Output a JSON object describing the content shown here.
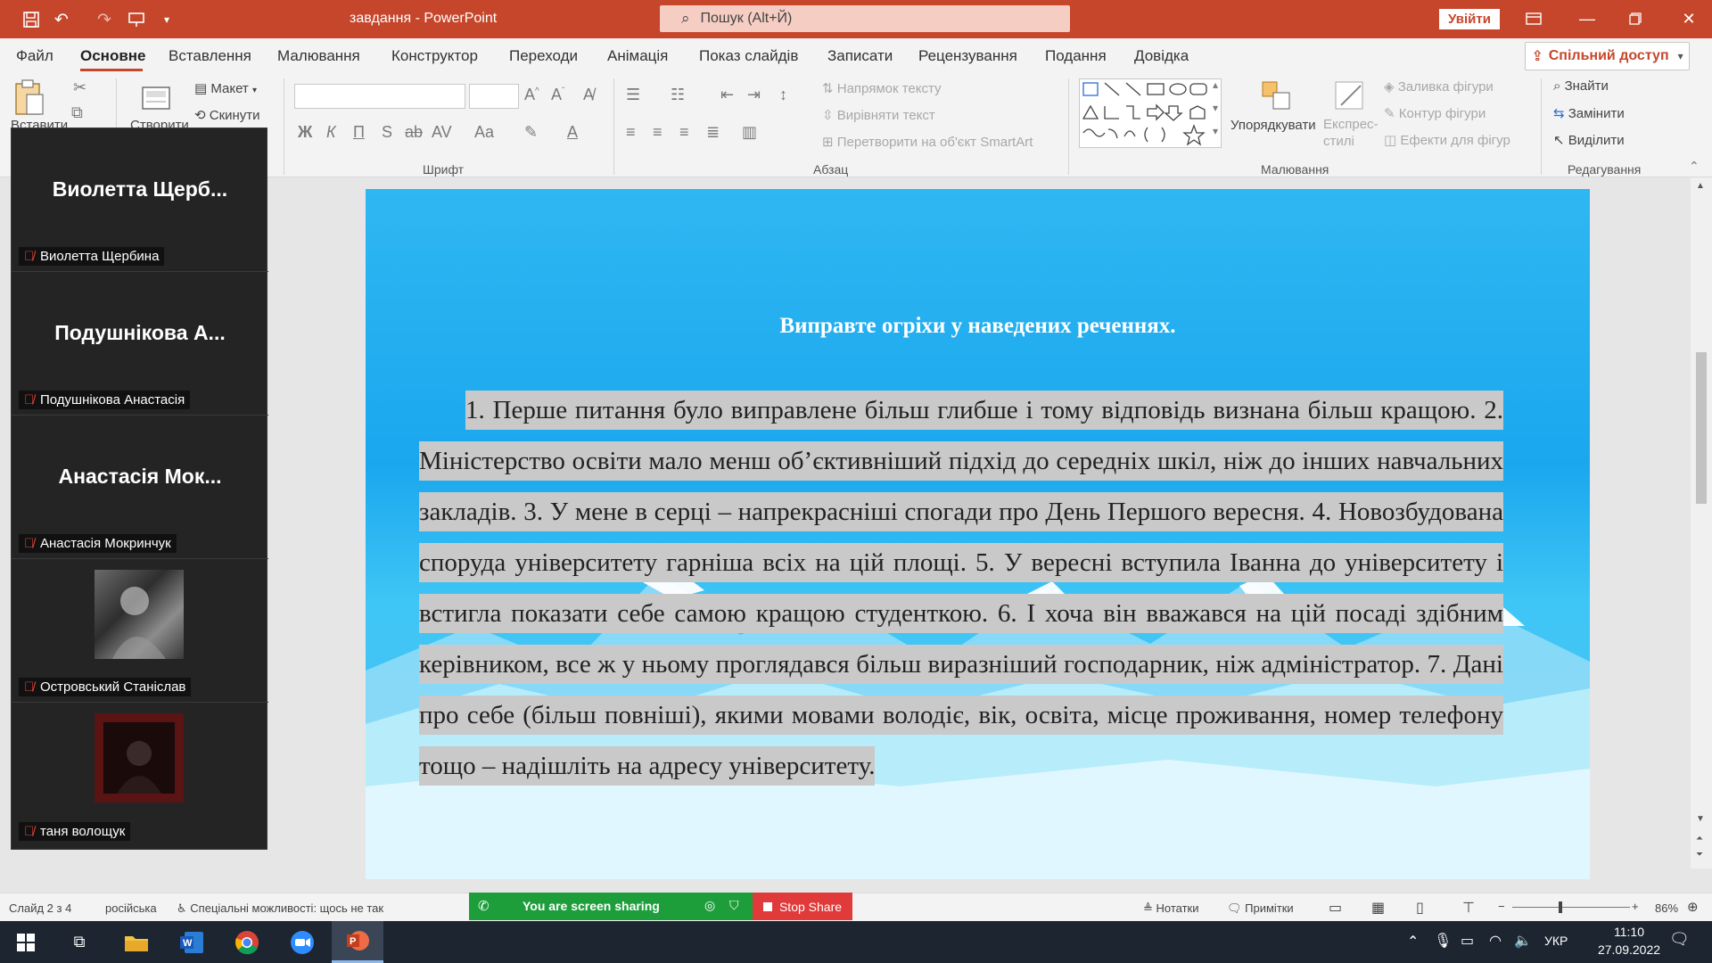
{
  "titlebar": {
    "doc_title": "завдання - PowerPoint",
    "search_placeholder": "Пошук (Alt+Й)",
    "signin_label": "Увійти"
  },
  "menu": {
    "items": [
      "Файл",
      "Основне",
      "Вставлення",
      "Малювання",
      "Конструктор",
      "Переходи",
      "Анімація",
      "Показ слайдів",
      "Записати",
      "Рецензування",
      "Подання",
      "Довідка"
    ],
    "active": "Основне",
    "share_label": "Спільний доступ"
  },
  "ribbon": {
    "paste_label": "Вставити",
    "create_label": "Створити",
    "layout_label": "Макет",
    "reset_label": "Скинути",
    "font_group": "Шрифт",
    "paragraph_group": "Абзац",
    "drawing_group": "Малювання",
    "editing_group": "Редагування",
    "text_direction": "Напрямок тексту",
    "align_text": "Вирівняти текст",
    "smartart": "Перетворити на об'єкт SmartArt",
    "arrange": "Упорядкувати",
    "quick_styles": "Експрес-стилі",
    "shape_fill": "Заливка фігури",
    "shape_outline": "Контур фігури",
    "shape_effects": "Ефекти для фігур",
    "find": "Знайти",
    "replace": "Замінити",
    "select": "Виділити"
  },
  "zoom": {
    "participants": [
      {
        "title": "Виолетта  Щерб...",
        "name": "Виолетта Щербина"
      },
      {
        "title": "Подушнікова А...",
        "name": "Подушнікова Анастасія"
      },
      {
        "title": "Анастасія Мок...",
        "name": "Анастасія Мокринчук"
      },
      {
        "title": "",
        "name": "Островський Станіслав"
      },
      {
        "title": "",
        "name": "таня волощук"
      }
    ],
    "sharing_text": "You are screen sharing",
    "stop_share": "Stop Share"
  },
  "slide": {
    "title": "Виправте огріхи у наведених реченнях.",
    "body": "1. Перше питання було виправлене більш глибше і тому відповідь визнана більш кращою. 2. Міністерство освіти мало менш об’єктивніший підхід до середніх шкіл, ніж до інших навчальних закладів. 3. У мене в серці – напрекрасніші спогади про День Першого вересня. 4. Новозбудована споруда університету гарніша всіх на цій площі. 5. У вересні вступила Іванна до університету і встигла показати себе самою кращою студенткою. 6. І хоча він вважався на цій посаді здібним керівником, все ж у ньому проглядався більш виразніший господарник, ніж адміністратор. 7. Дані про себе (більш повніші), якими мовами володіє, вік, освіта, місце проживання, номер телефону тощо – надішліть на адресу університету."
  },
  "status": {
    "slide_info": "Слайд 2 з 4",
    "language": "російська",
    "accessibility": "Спеціальні можливості: щось не так",
    "notes": "Нотатки",
    "comments": "Примітки",
    "zoom_level": "86%"
  },
  "taskbar": {
    "language": "УКР",
    "time": "11:10",
    "date": "27.09.2022"
  },
  "colors": {
    "accent": "#c6462b",
    "slide_bg": "#1aa7ee",
    "share_green": "#1e9e3b",
    "stop_red": "#e03a3a"
  }
}
